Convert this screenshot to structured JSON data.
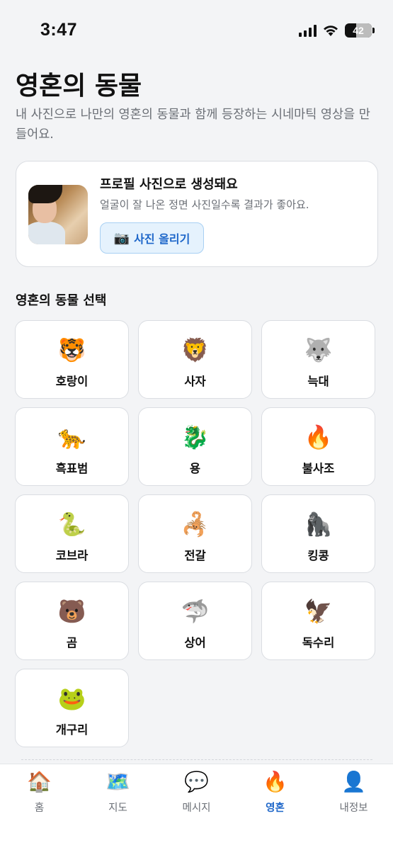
{
  "status_bar": {
    "time": "3:47",
    "battery": "42"
  },
  "header": {
    "title": "영혼의 동물",
    "subtitle": "내 사진으로 나만의 영혼의 동물과 함께 등장하는 시네마틱 영상을 만들어요."
  },
  "profile_card": {
    "title": "프로필 사진으로 생성돼요",
    "description": "얼굴이 잘 나온 정면 사진일수록 결과가 좋아요.",
    "upload_icon": "📷",
    "upload_label": "사진 올리기"
  },
  "animals": {
    "section_title": "영혼의 동물 선택",
    "items": [
      {
        "emoji": "🐯",
        "label": "호랑이"
      },
      {
        "emoji": "🦁",
        "label": "사자"
      },
      {
        "emoji": "🐺",
        "label": "늑대"
      },
      {
        "emoji": "🐆",
        "label": "흑표범"
      },
      {
        "emoji": "🐉",
        "label": "용"
      },
      {
        "emoji": "🔥",
        "label": "불사조"
      },
      {
        "emoji": "🐍",
        "label": "코브라"
      },
      {
        "emoji": "🦂",
        "label": "전갈"
      },
      {
        "emoji": "🦍",
        "label": "킹콩"
      },
      {
        "emoji": "🐻",
        "label": "곰"
      },
      {
        "emoji": "🦈",
        "label": "상어"
      },
      {
        "emoji": "🦅",
        "label": "독수리"
      },
      {
        "emoji": "🐸",
        "label": "개구리"
      }
    ]
  },
  "tab_bar": {
    "active_color": "#1d66c9",
    "tabs": [
      {
        "icon": "🏠",
        "label": "홈"
      },
      {
        "icon": "🗺️",
        "label": "지도"
      },
      {
        "icon": "💬",
        "label": "메시지"
      },
      {
        "icon": "🔥",
        "label": "영혼"
      },
      {
        "icon": "👤",
        "label": "내정보"
      }
    ]
  }
}
